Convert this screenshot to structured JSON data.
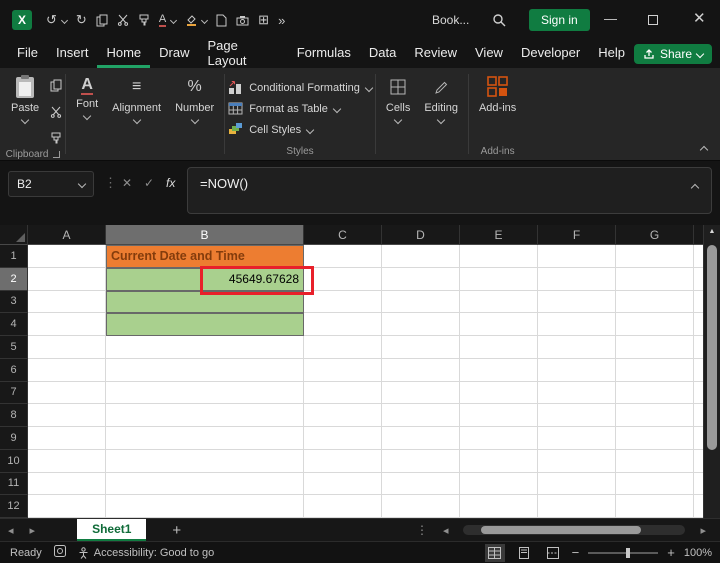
{
  "titlebar": {
    "title": "Book...",
    "sign_in_label": "Sign in"
  },
  "menubar": {
    "items": [
      "File",
      "Insert",
      "Home",
      "Draw",
      "Page Layout",
      "Formulas",
      "Data",
      "Review",
      "View",
      "Developer",
      "Help"
    ],
    "active_item": "Home",
    "share_label": "Share"
  },
  "ribbon": {
    "paste_label": "Paste",
    "clipboard_group_label": "Clipboard",
    "font_label": "Font",
    "alignment_label": "Alignment",
    "number_label": "Number",
    "conditional_formatting_label": "Conditional Formatting",
    "format_as_table_label": "Format as Table",
    "cell_styles_label": "Cell Styles",
    "styles_group_label": "Styles",
    "cells_label": "Cells",
    "editing_label": "Editing",
    "addins_button_label": "Add-ins",
    "addins_group_label": "Add-ins"
  },
  "formula_bar": {
    "name_box_value": "B2",
    "fx_label": "fx",
    "formula": "=NOW()"
  },
  "grid": {
    "columns": [
      "A",
      "B",
      "C",
      "D",
      "E",
      "F",
      "G"
    ],
    "rows": [
      "1",
      "2",
      "3",
      "4",
      "5",
      "6",
      "7",
      "8",
      "9",
      "10",
      "11",
      "12"
    ],
    "selected_column": "B",
    "selected_row": "2",
    "cells": [
      {
        "col": "B",
        "row": "1",
        "text": "Current Date and Time",
        "style": "orange-header"
      },
      {
        "col": "B",
        "row": "2",
        "text": "45649.67628",
        "style": "green-value"
      },
      {
        "col": "B",
        "row": "3",
        "text": "",
        "style": "green-fill"
      },
      {
        "col": "B",
        "row": "4",
        "text": "",
        "style": "green-fill"
      }
    ]
  },
  "sheet_tabs": {
    "active_sheet": "Sheet1"
  },
  "status_bar": {
    "ready_label": "Ready",
    "accessibility_label": "Accessibility: Good to go",
    "zoom_value": "100%"
  },
  "colors": {
    "accent_green": "#107C41",
    "menu_underline_green": "#21A366",
    "header_fill": "#ED7D31",
    "header_text": "#843C0C",
    "value_fill": "#A9D08E",
    "annotation_red": "#E8202A"
  }
}
